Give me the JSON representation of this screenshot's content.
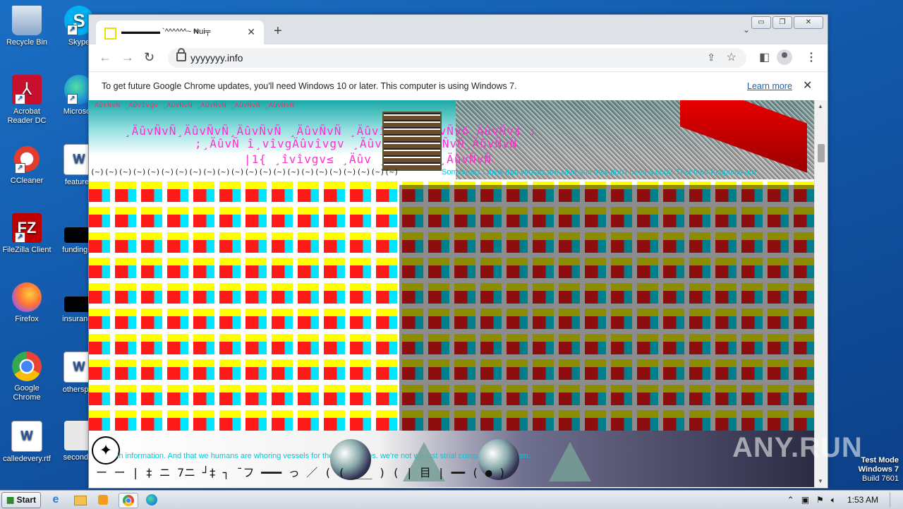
{
  "desktop": {
    "icons": [
      {
        "label": "Recycle Bin",
        "icon": "recycle-bin-icon"
      },
      {
        "label": "Skype",
        "icon": "skype-icon"
      },
      {
        "label": "Acrobat Reader DC",
        "icon": "acrobat-icon"
      },
      {
        "label": "Microsoft",
        "icon": "edge-icon"
      },
      {
        "label": "CCleaner",
        "icon": "ccleaner-icon"
      },
      {
        "label": "featured",
        "icon": "word-doc-icon"
      },
      {
        "label": "FileZilla Client",
        "icon": "filezilla-icon"
      },
      {
        "label": "fundingse",
        "icon": "blank-file-icon"
      },
      {
        "label": "Firefox",
        "icon": "firefox-icon"
      },
      {
        "label": "insurance",
        "icon": "blank-file-icon"
      },
      {
        "label": "Google Chrome",
        "icon": "chrome-icon"
      },
      {
        "label": "otherspor",
        "icon": "word-doc-icon"
      },
      {
        "label": "calledevery.rtf",
        "icon": "word-doc-icon"
      },
      {
        "label": "secondto",
        "icon": "blank-file-icon"
      }
    ]
  },
  "browser": {
    "tab_title": "▬▬▬▬▬ `^^^^^^~ ₦ui╤",
    "url": "yyyyyyy.info",
    "infobar_message": "To get future Google Chrome updates, you'll need Windows 10 or later. This computer is using Windows 7.",
    "infobar_link": "Learn more",
    "controls": {
      "minimize": "▭",
      "restore": "❐",
      "close": "✕"
    }
  },
  "page": {
    "glitch_line1": "ÂûvÑvÑ ¸Äûvîvgv ¸ÄûvÑvÑ ¸ÄûvÑvÑ ¸ÄûvÑvÑ ¸ÄûvÑvÑ",
    "glitch_line2": "¸ÄûvÑvÑ¸ÄûvÑvÑ¸ÄûvÑvÑ ¸ÄûvÑvÑ  ¸Äûvîvgv™¸ÄûvÑvö¸ÄûvÑv¢ :",
    "glitch_line3": ";¸ÄûvÑ  î¸vîvgÄûvîvgv  ¸ÄûvÑvg  ¸ÄûvÑvÑ¸ÄûvÑvÑ",
    "glitch_line4": "|1{ ¸îvîvgv≤ ¸Äûv  ¸ÄûvÑvÑ ¸ÄûvÑvÑ",
    "tilde_row": "(~)(~)(~)(~)(~)(~)(~)(~)(~)(~)(~)(~)(~)(~)(~)(~)(~)(~)(~)(~)(~)(~)",
    "ticker_top": "Sometimes I think that viruses are alive and they don't need a body. That their footprints are",
    "ticker_bottom": "in information. And that we humans are whoring vessels for these creatures.      we're not       we just         strial compared with them.",
    "ascii_bottom": "ー ー |  ‡ ニ  7ニ  ┘‡  ┐ ̄  フ  ━━━ っ  ／ ( ( ___ ) (  | 目 |  ━━  ( ● )"
  },
  "watermark": "ANY.RUN",
  "test_mode": {
    "line1": "Test Mode",
    "line2": "Windows 7",
    "line3": "Build 7601"
  },
  "taskbar": {
    "start_label": "Start",
    "clock": "1:53 AM"
  }
}
